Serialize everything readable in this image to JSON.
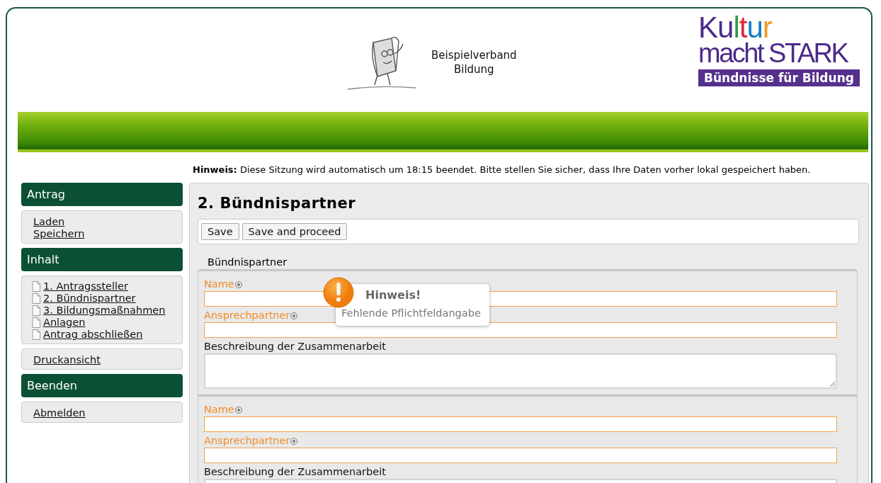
{
  "header": {
    "org_name": "Beispielverband\nBildung",
    "logo": {
      "line1": [
        {
          "text": "Ku",
          "color": "#4b2a8a"
        },
        {
          "text": "l",
          "color": "#2e9a47"
        },
        {
          "text": "t",
          "color": "#e0263c"
        },
        {
          "text": "u",
          "color": "#1a7cc4"
        },
        {
          "text": "r",
          "color": "#f29a1f"
        }
      ],
      "line2": "macht STARK",
      "banner": "Bündnisse für Bildung"
    }
  },
  "notice": {
    "label": "Hinweis:",
    "text": "Diese Sitzung wird automatisch um 18:15 beendet. Bitte stellen Sie sicher, dass Ihre Daten vorher lokal gespeichert haben."
  },
  "sidebar": [
    {
      "kind": "heading",
      "text": "Antrag"
    },
    {
      "kind": "links",
      "items": [
        "Laden",
        "Speichern"
      ]
    },
    {
      "kind": "heading",
      "text": "Inhalt"
    },
    {
      "kind": "pages",
      "items": [
        "1. Antragssteller",
        "2. Bündnispartner",
        "3. Bildungsmaßnahmen",
        "Anlagen",
        "Antrag abschließen"
      ]
    },
    {
      "kind": "links",
      "items": [
        "Druckansicht"
      ]
    },
    {
      "kind": "heading",
      "text": "Beenden"
    },
    {
      "kind": "links",
      "items": [
        "Abmelden"
      ]
    }
  ],
  "main": {
    "title": "2. Bündnispartner",
    "buttons": [
      "Save",
      "Save and proceed"
    ],
    "legend": "Bündnispartner",
    "partners": [
      {
        "fields": [
          {
            "kind": "text",
            "label": "Name",
            "required": true
          },
          {
            "kind": "text",
            "label": "Ansprechpartner",
            "required": true
          },
          {
            "kind": "textarea",
            "label": "Beschreibung der Zusammenarbeit",
            "required": false
          }
        ],
        "tooltip": {
          "title": "Hinweis!",
          "message": "Fehlende Pflichtfeldangabe"
        }
      },
      {
        "fields": [
          {
            "kind": "text",
            "label": "Name",
            "required": true
          },
          {
            "kind": "text",
            "label": "Ansprechpartner",
            "required": true
          },
          {
            "kind": "textarea",
            "label": "Beschreibung der Zusammenarbeit",
            "required": false
          }
        ]
      }
    ]
  }
}
